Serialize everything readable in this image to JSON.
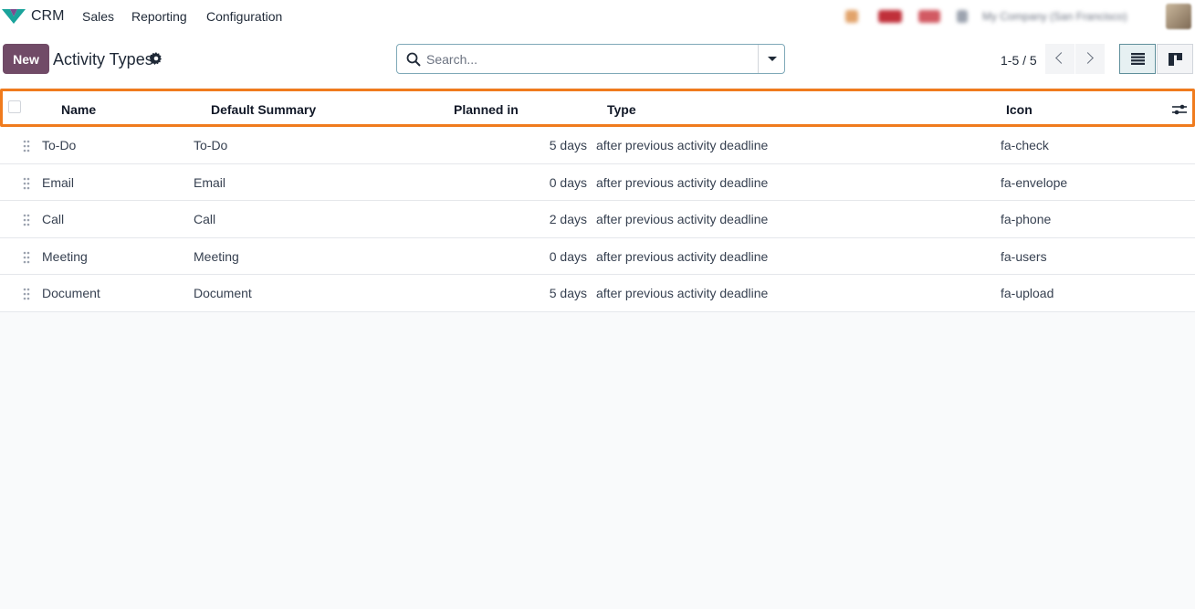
{
  "navbar": {
    "app_name": "CRM",
    "menu": [
      "Sales",
      "Reporting",
      "Configuration"
    ],
    "company": "My Company (San Francisco)"
  },
  "control_panel": {
    "new_label": "New",
    "title": "Activity Types",
    "search_placeholder": "Search...",
    "pager": "1-5 / 5"
  },
  "table": {
    "columns": [
      "Name",
      "Default Summary",
      "Planned in",
      "Type",
      "Icon"
    ],
    "rows": [
      {
        "name": "To-Do",
        "summary": "To-Do",
        "planned": "5 days",
        "type": "after previous activity deadline",
        "icon": "fa-check"
      },
      {
        "name": "Email",
        "summary": "Email",
        "planned": "0 days",
        "type": "after previous activity deadline",
        "icon": "fa-envelope"
      },
      {
        "name": "Call",
        "summary": "Call",
        "planned": "2 days",
        "type": "after previous activity deadline",
        "icon": "fa-phone"
      },
      {
        "name": "Meeting",
        "summary": "Meeting",
        "planned": "0 days",
        "type": "after previous activity deadline",
        "icon": "fa-users"
      },
      {
        "name": "Document",
        "summary": "Document",
        "planned": "5 days",
        "type": "after previous activity deadline",
        "icon": "fa-upload"
      }
    ]
  },
  "colors": {
    "primary": "#714b67",
    "highlight": "#f07b1d",
    "search_border": "#7fa9b8"
  }
}
